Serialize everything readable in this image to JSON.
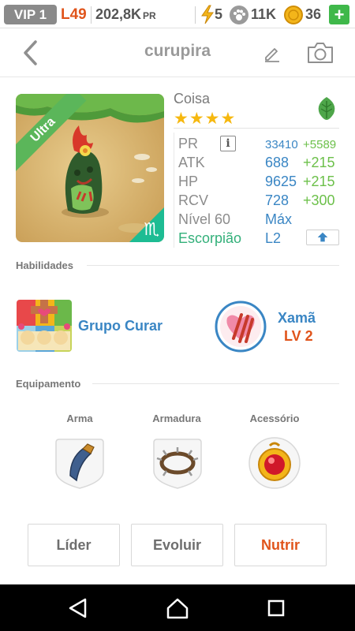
{
  "topbar": {
    "vip": "VIP 1",
    "level": "L49",
    "pr": "202,8K",
    "pr_unit": "PR",
    "stamina": "5",
    "paws": "11K",
    "coins": "36",
    "add_label": "+"
  },
  "header": {
    "title": "curupira"
  },
  "pet": {
    "rarity": "Ultra",
    "name": "Coisa",
    "stars": "★★★★",
    "zodiac_glyph": "♏",
    "stats": {
      "pr_label": "PR",
      "pr_value": "33410",
      "pr_bonus": "+5589",
      "atk_label": "ATK",
      "atk_value": "688",
      "atk_bonus": "+215",
      "hp_label": "HP",
      "hp_value": "9625",
      "hp_bonus": "+215",
      "rcv_label": "RCV",
      "rcv_value": "728",
      "rcv_bonus": "+300",
      "level_label": "Nível 60",
      "level_value": "Máx",
      "zodiac_label": "Escorpião",
      "zodiac_level": "L2"
    }
  },
  "skills": {
    "section_label": "Habilidades",
    "skill_name": "Grupo Curar",
    "class_name": "Xamã",
    "class_level": "LV 2"
  },
  "equipment": {
    "section_label": "Equipamento",
    "weapon_label": "Arma",
    "armor_label": "Armadura",
    "accessory_label": "Acessório"
  },
  "actions": {
    "leader": "Líder",
    "evolve": "Evoluir",
    "feed": "Nutrir"
  },
  "colors": {
    "accent_blue": "#3a86c4",
    "bonus_green": "#6cc04a",
    "orange": "#e0541b",
    "zodiac_teal": "#33b07a"
  }
}
